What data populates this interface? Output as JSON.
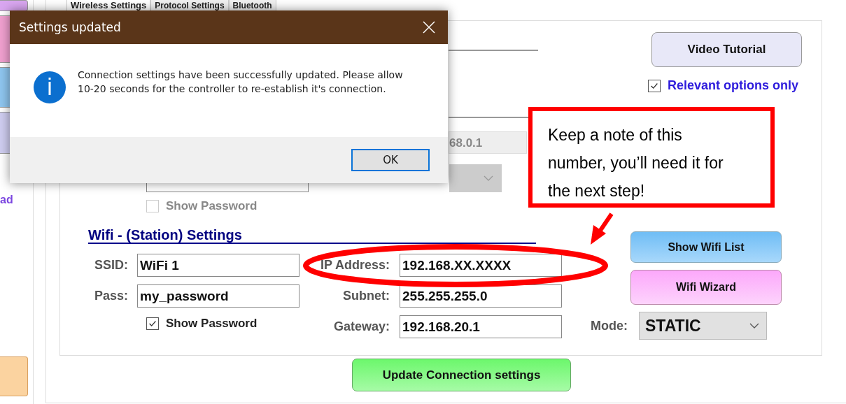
{
  "sidebar": {
    "link": "ad"
  },
  "tabs": [
    {
      "label": "Wireless Settings",
      "selected": true
    },
    {
      "label": "Protocol Settings",
      "selected": false
    },
    {
      "label": "Bluetooth",
      "selected": false
    }
  ],
  "video_tutorial_button": "Video Tutorial",
  "relevant_options": {
    "label": "Relevant options only",
    "checked": true
  },
  "access_point": {
    "ip_field": {
      "value": "68.0.1"
    },
    "show_password": {
      "label": "Show Password",
      "checked": false,
      "disabled": true
    }
  },
  "station": {
    "title": "Wifi - (Station) Settings",
    "fields": [
      {
        "label": "SSID:",
        "value": "WiFi 1"
      },
      {
        "label": "Pass:",
        "value": "my_password"
      }
    ],
    "show_password": {
      "label": "Show Password",
      "checked": true,
      "disabled": false
    },
    "network_fields": [
      {
        "label": "IP Address:",
        "value": "192.168.XX.XXXX"
      },
      {
        "label": "Subnet:",
        "value": "255.255.255.0"
      },
      {
        "label": "Gateway:",
        "value": "192.168.20.1"
      }
    ],
    "buttons": [
      {
        "kind": "list",
        "label": "Show Wifi List"
      },
      {
        "kind": "wizard",
        "label": "Wifi Wizard"
      }
    ],
    "mode": {
      "label": "Mode:",
      "value": "STATIC"
    }
  },
  "update_button": "Update Connection settings",
  "dialog": {
    "title": "Settings updated",
    "message": "Connection settings have been successfully updated. Please allow 10-20 seconds for the controller to re-establish it's connection.",
    "ok": "OK"
  },
  "callout": {
    "text": "Keep a note of this number, you’ll need it for the next step!"
  }
}
